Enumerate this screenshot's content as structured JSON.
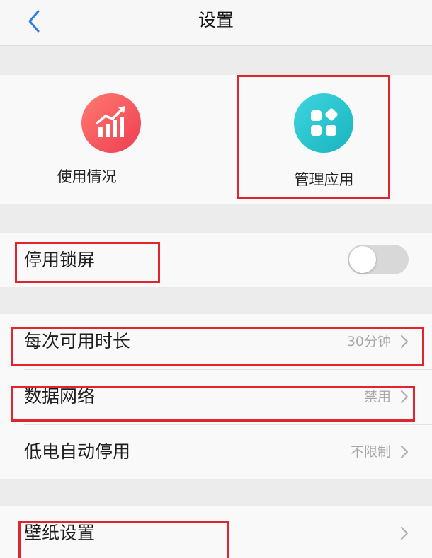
{
  "header": {
    "title": "设置",
    "back_icon": "chevron-left-icon",
    "accent_color": "#2f7de1"
  },
  "apps": {
    "usage": {
      "label": "使用情况",
      "icon": "chart-trend-icon",
      "color": "#f04c5c"
    },
    "manage": {
      "label": "管理应用",
      "icon": "apps-grid-icon",
      "color": "#22c1cb"
    }
  },
  "lock": {
    "label": "停用锁屏",
    "enabled": false
  },
  "rows": [
    {
      "label": "每次可用时长",
      "value": "30分钟"
    },
    {
      "label": "数据网络",
      "value": "禁用"
    },
    {
      "label": "低电自动停用",
      "value": "不限制"
    }
  ],
  "wallpaper": {
    "label": "壁纸设置",
    "value": ""
  },
  "highlight_color": "#e0252f"
}
